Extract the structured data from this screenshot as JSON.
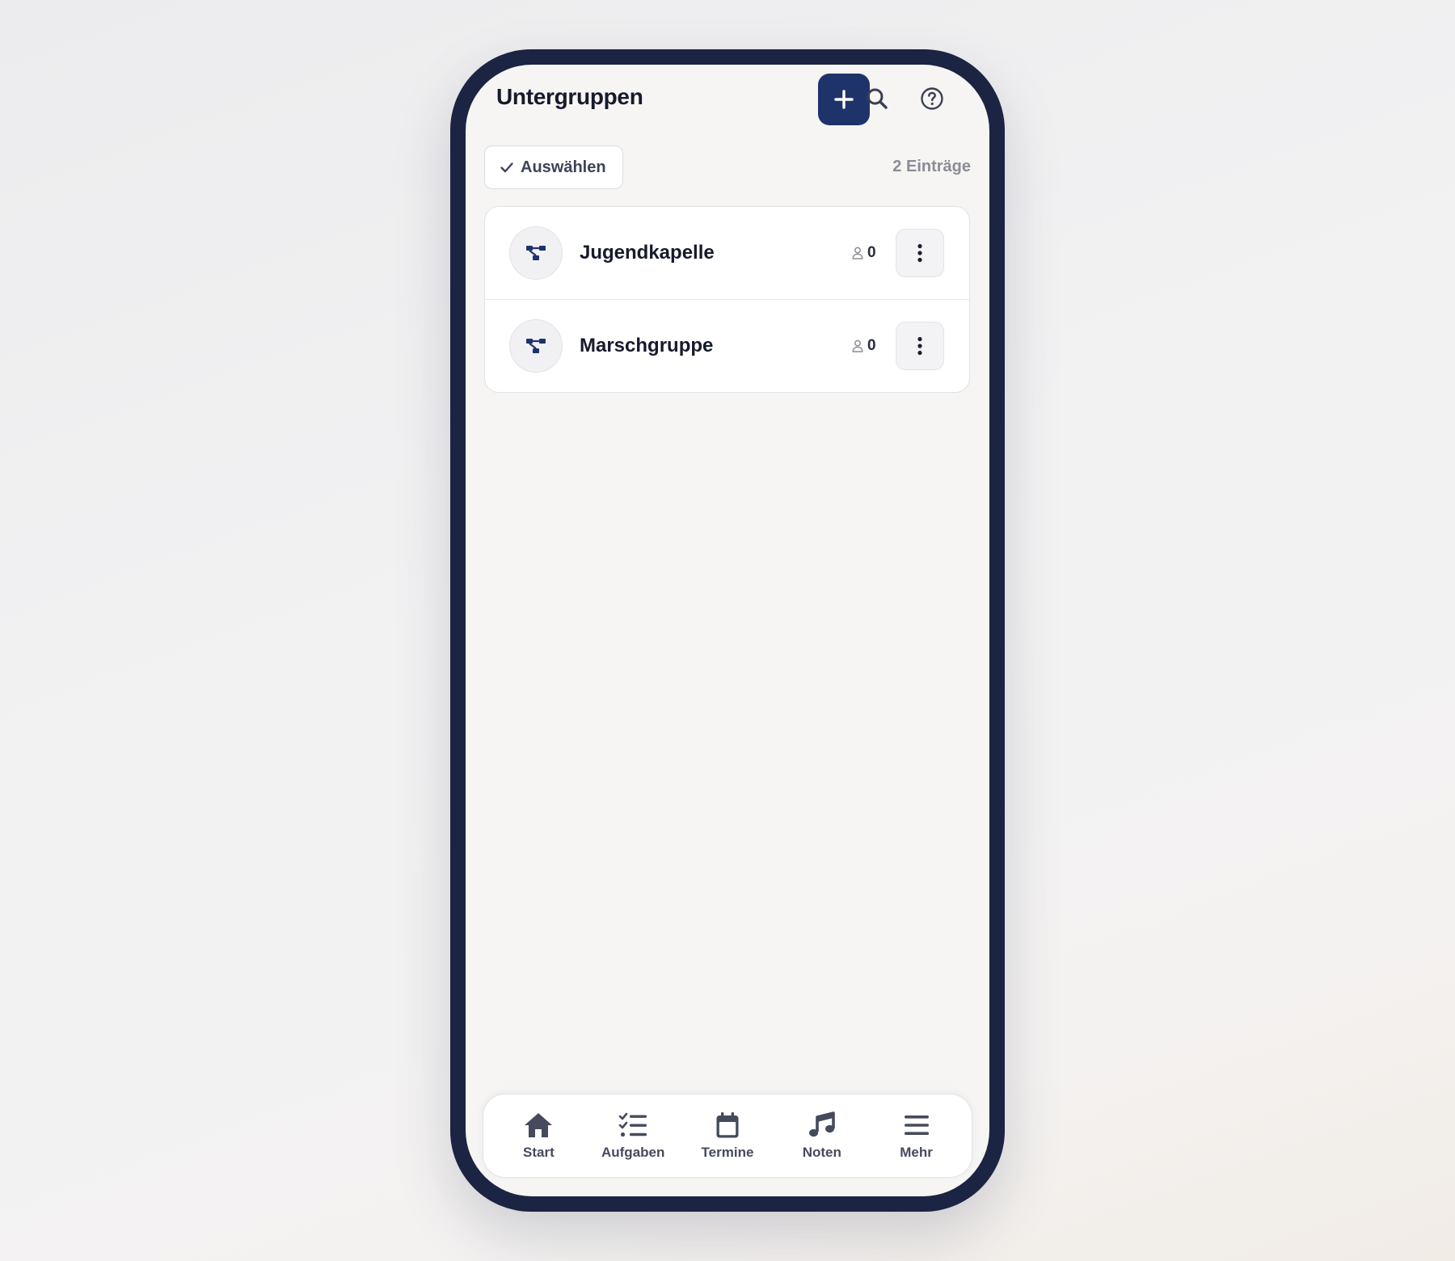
{
  "header": {
    "title": "Untergruppen",
    "add_icon": "plus-icon",
    "search_icon": "search-icon",
    "help_icon": "help-circle-icon"
  },
  "toolbar": {
    "select_label": "Auswählen",
    "select_icon": "check-icon",
    "entry_count": "2 Einträge"
  },
  "groups": [
    {
      "name": "Jugendkapelle",
      "members": "0",
      "icon": "subgroup-icon"
    },
    {
      "name": "Marschgruppe",
      "members": "0",
      "icon": "subgroup-icon"
    }
  ],
  "bottom_nav": {
    "items": [
      {
        "label": "Start",
        "icon": "home-icon"
      },
      {
        "label": "Aufgaben",
        "icon": "checklist-icon"
      },
      {
        "label": "Termine",
        "icon": "calendar-icon"
      },
      {
        "label": "Noten",
        "icon": "music-note-icon"
      },
      {
        "label": "Mehr",
        "icon": "menu-icon"
      }
    ]
  },
  "colors": {
    "frame": "#1b2442",
    "accent": "#1f336b",
    "screen_bg": "#f6f5f3",
    "text_primary": "#161a2b",
    "text_muted": "#8b8d95"
  }
}
